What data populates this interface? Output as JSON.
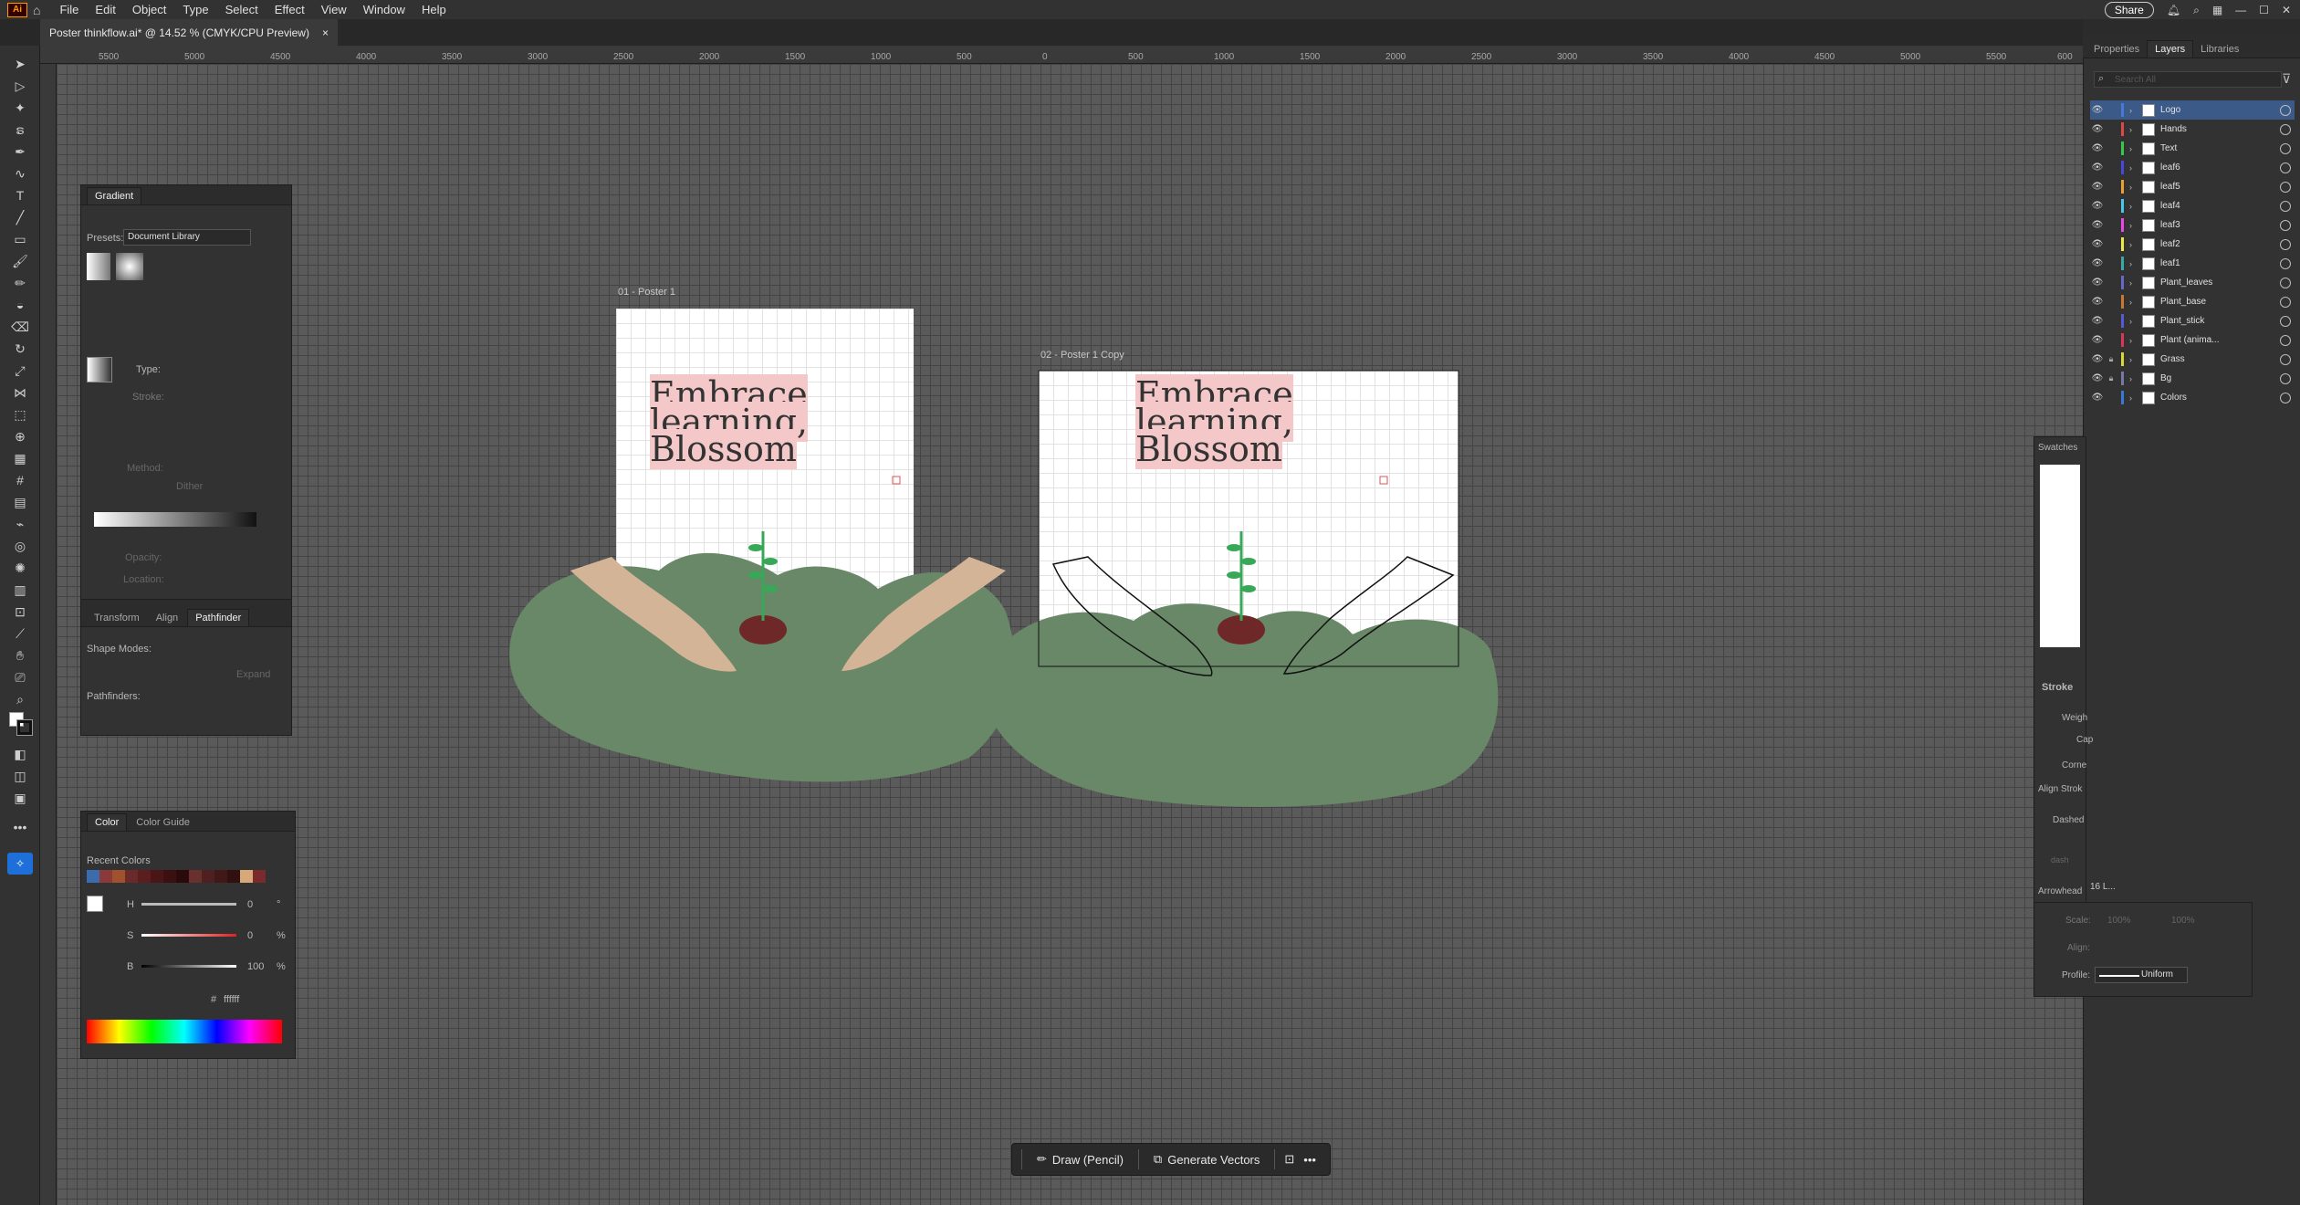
{
  "app": {
    "logo": "Ai",
    "menu": [
      "File",
      "Edit",
      "Object",
      "Type",
      "Select",
      "Effect",
      "View",
      "Window",
      "Help"
    ],
    "share_label": "Share"
  },
  "document": {
    "tab_title": "Poster thinkflow.ai* @ 14.52 % (CMYK/CPU Preview)",
    "close_glyph": "×"
  },
  "ruler": {
    "top_ticks": [
      "5500",
      "5000",
      "4500",
      "4000",
      "3500",
      "3000",
      "2500",
      "2000",
      "1500",
      "1000",
      "500",
      "0",
      "500",
      "1000",
      "1500",
      "2000",
      "2500",
      "3000",
      "3500",
      "4000",
      "4500",
      "5000",
      "5500",
      "600"
    ]
  },
  "artboards": [
    {
      "label": "01 - Poster 1",
      "headline": [
        "Embrace",
        "learning,",
        "Blossom"
      ]
    },
    {
      "label": "02 - Poster 1 Copy",
      "headline": [
        "Embrace",
        "learning,",
        "Blossom"
      ]
    }
  ],
  "gradient_panel": {
    "title": "Gradient",
    "presets_label": "Presets:",
    "presets_value": "Document Library",
    "type_label": "Type:",
    "stroke_label": "Stroke:",
    "method_label": "Method:",
    "dither_label": "Dither",
    "opacity_label": "Opacity:",
    "location_label": "Location:"
  },
  "pathfinder_panel": {
    "tabs": [
      "Transform",
      "Align",
      "Pathfinder"
    ],
    "shape_modes_label": "Shape Modes:",
    "expand_label": "Expand",
    "pathfinders_label": "Pathfinders:"
  },
  "color_panel": {
    "tabs": [
      "Color",
      "Color Guide"
    ],
    "recent_label": "Recent Colors",
    "recent_colors": [
      "#3a6db0",
      "#8b3a3a",
      "#a0522d",
      "#6b2a2a",
      "#5a1e1e",
      "#4a1515",
      "#3a1010",
      "#2a0a0a",
      "#6a3030",
      "#502020",
      "#401818",
      "#301010",
      "#d8a878",
      "#7a2a2a"
    ],
    "h_label": "H",
    "h_value": "0",
    "h_unit": "°",
    "s_label": "S",
    "s_value": "0",
    "s_unit": "%",
    "b_label": "B",
    "b_value": "100",
    "b_unit": "%",
    "hex_symbol": "#",
    "hex_value": "ffffff"
  },
  "right_tabs": [
    "Properties",
    "Layers",
    "Libraries"
  ],
  "layers_search_placeholder": "Search All",
  "layers": [
    {
      "name": "Logo",
      "color": "#4a78d8",
      "selected": true
    },
    {
      "name": "Hands",
      "color": "#e04848"
    },
    {
      "name": "Text",
      "color": "#38c848"
    },
    {
      "name": "leaf6",
      "color": "#4848e0"
    },
    {
      "name": "leaf5",
      "color": "#e8a030"
    },
    {
      "name": "leaf4",
      "color": "#48c8e8"
    },
    {
      "name": "leaf3",
      "color": "#e848e8"
    },
    {
      "name": "leaf2",
      "color": "#e8e848"
    },
    {
      "name": "leaf1",
      "color": "#38a8a8"
    },
    {
      "name": "Plant_leaves",
      "color": "#6868c8"
    },
    {
      "name": "Plant_base",
      "color": "#c87830"
    },
    {
      "name": "Plant_stick",
      "color": "#5858d8"
    },
    {
      "name": "Plant (anima...",
      "color": "#d83858"
    },
    {
      "name": "Grass",
      "color": "#d8d838",
      "locked": true
    },
    {
      "name": "Bg",
      "color": "#7878a8",
      "locked": true
    },
    {
      "name": "Colors",
      "color": "#3878d8"
    }
  ],
  "layers_footer": "16 L...",
  "swatches_label": "Swatches",
  "stroke_panel": {
    "title": "Stroke",
    "weight_label": "Weigh",
    "cap_label": "Cap",
    "corner_label": "Corne",
    "align_label": "Align Strok",
    "dashed_label": "Dashed",
    "dash_label": "dash",
    "arrowheads_label": "Arrowhead",
    "scale_label": "Scale:",
    "scale1": "100%",
    "scale2": "100%",
    "align2_label": "Align:",
    "profile_label": "Profile:",
    "profile_value": "Uniform"
  },
  "context_bar": {
    "draw_label": "Draw (Pencil)",
    "generate_label": "Generate Vectors",
    "more_glyph": "•••"
  },
  "colors": {
    "hill": "#688868",
    "hand": "#d4b496",
    "soil": "#6e2828",
    "leaf": "#38a858",
    "highlight": "#f4c8c8"
  }
}
